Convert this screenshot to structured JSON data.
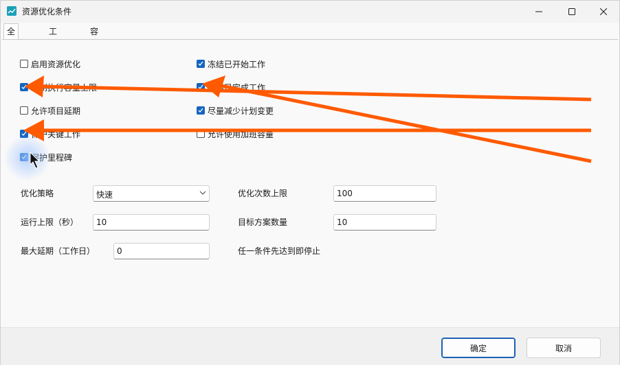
{
  "window": {
    "title": "资源优化条件",
    "controls": [
      "minimize",
      "maximize",
      "close"
    ]
  },
  "tabs": [
    {
      "label": "全局设置",
      "active": true
    },
    {
      "label": "工作约束",
      "active": false
    },
    {
      "label": "容量时段",
      "active": false
    }
  ],
  "checkboxes": {
    "enable_resource_opt": {
      "label": "启用资源优化",
      "checked": false
    },
    "enforce_capacity_limit": {
      "label": "强制执行容量上限",
      "checked": true
    },
    "allow_project_delay": {
      "label": "允许项目延期",
      "checked": false
    },
    "protect_critical_work": {
      "label": "保护关键工作",
      "checked": true
    },
    "protect_milestone": {
      "label": "保护里程碑",
      "checked": true
    },
    "freeze_started_work": {
      "label": "冻结已开始工作",
      "checked": true
    },
    "freeze_completed_work": {
      "label": "冻结已完成工作",
      "checked": true
    },
    "minimize_plan_changes": {
      "label": "尽量减少计划变更",
      "checked": true
    },
    "allow_overtime_capacity": {
      "label": "允许使用加班容量",
      "checked": false
    }
  },
  "fields": {
    "strategy": {
      "label": "优化策略",
      "value": "快速"
    },
    "max_iterations": {
      "label": "优化次数上限",
      "value": "100"
    },
    "time_limit": {
      "label": "运行上限（秒）",
      "value": "10"
    },
    "target_solutions": {
      "label": "目标方案数量",
      "value": "10"
    },
    "max_delay": {
      "label": "最大延期（工作日）",
      "value": "0"
    },
    "stop_note": "任一条件先达到即停止"
  },
  "buttons": {
    "ok": "确定",
    "cancel": "取消"
  },
  "colors": {
    "accent": "#1565c0",
    "annotation_arrow": "#ff5a00"
  }
}
